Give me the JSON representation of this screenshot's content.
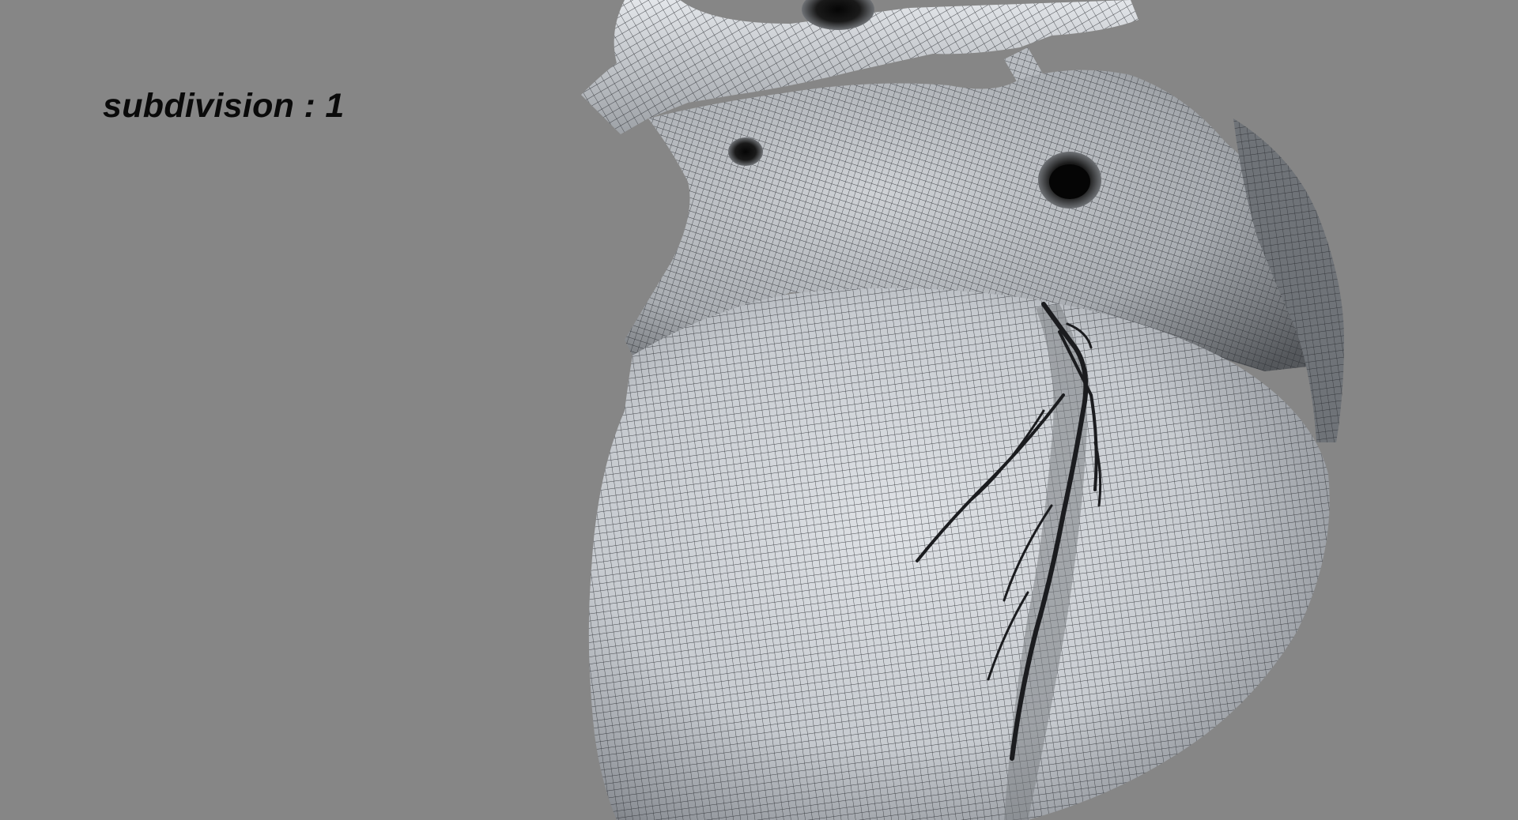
{
  "viewport": {
    "background_color": "#868686",
    "subdivision_label": "subdivision : 1"
  },
  "model": {
    "subject": "heart-mesh",
    "display_mode": "wireframe-on-shaded",
    "surface_color": "#c9cdd2",
    "wire_color": "#2b2e33"
  }
}
